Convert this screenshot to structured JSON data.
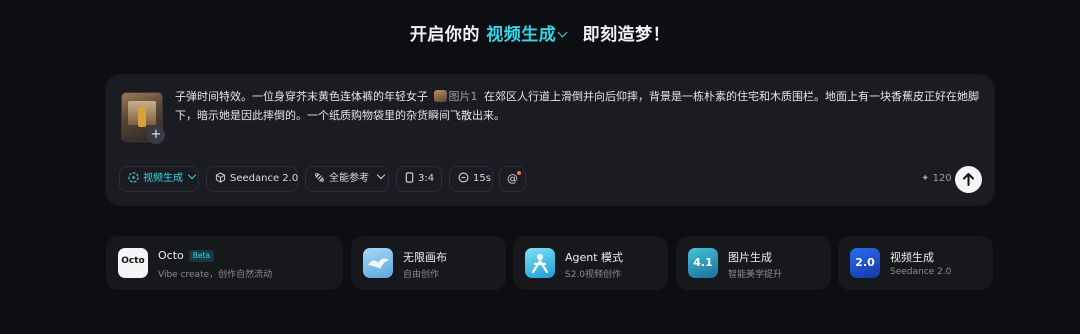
{
  "headline": {
    "prefix": "开启你的",
    "mode": "视频生成",
    "suffix": "即刻造梦！"
  },
  "composer": {
    "prompt_part1": "子弹时间特效。一位身穿芥末黄色连体裤的年轻女子",
    "ref_label": "图片1",
    "prompt_part2": "在郊区人行道上滑倒并向后仰摔，背景是一栋朴素的住宅和木质围栏。地面上有一块香蕉皮正好在她脚下，暗示她是因此摔倒的。一个纸质购物袋里的杂货瞬间飞散出来。",
    "add_glyph": "+",
    "toolbar": {
      "mode": "视频生成",
      "model": "Seedance 2.0",
      "reference": "全能参考",
      "ratio": "3:4",
      "duration": "15s",
      "mention": "@"
    },
    "credits": "120",
    "credits_glyph": "✦"
  },
  "cards": [
    {
      "title": "Octo",
      "badge": "Beta",
      "subtitle": "Vibe create，创作自然流动",
      "icon": "octo-logo",
      "icon_text": "Octo"
    },
    {
      "title": "无限画布",
      "subtitle": "自由创作",
      "icon": "bird-canvas-icon"
    },
    {
      "title": "Agent 模式",
      "subtitle": "S2.0视频创作",
      "icon": "agent-figure-icon"
    },
    {
      "title": "图片生成",
      "subtitle": "智能美学提升",
      "icon": "image-gen-icon",
      "icon_text": "4.1"
    },
    {
      "title": "视频生成",
      "subtitle": "Seedance 2.0",
      "icon": "video-gen-icon",
      "icon_text": "2.0"
    }
  ],
  "colors": {
    "accent": "#33d6e8",
    "background": "#0d0e12",
    "panel": "#1b1c21"
  }
}
